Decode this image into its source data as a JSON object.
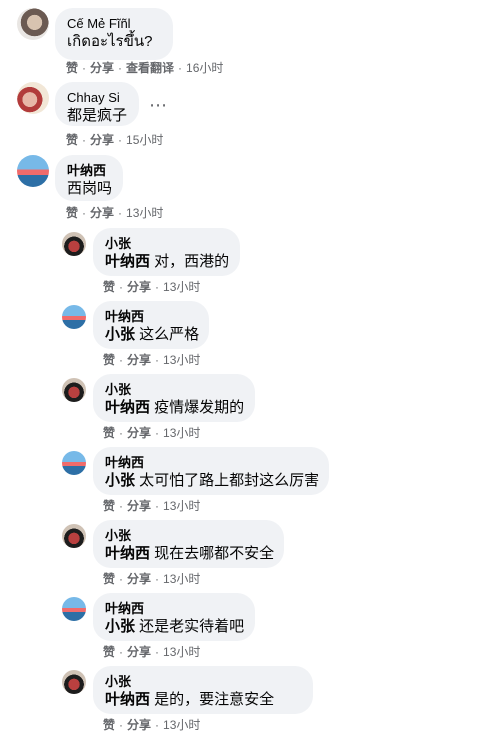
{
  "comments": [
    {
      "author": "Cế Mẻ Fĩñl",
      "text": "เกิดอะไรขึ้น?",
      "like": "赞",
      "share": "分享",
      "translate": "查看翻译",
      "time": "16小时"
    },
    {
      "author": "Chhay Si",
      "text": "都是疯子",
      "like": "赞",
      "share": "分享",
      "time": "15小时"
    },
    {
      "author": "叶纳西",
      "text": "西岗吗",
      "like": "赞",
      "share": "分享",
      "time": "13小时"
    }
  ],
  "replies": [
    {
      "author": "小张",
      "mention": "叶纳西",
      "text": " 对，西港的",
      "like": "赞",
      "share": "分享",
      "time": "13小时"
    },
    {
      "author": "叶纳西",
      "mention": "小张",
      "text": " 这么严格",
      "like": "赞",
      "share": "分享",
      "time": "13小时"
    },
    {
      "author": "小张",
      "mention": "叶纳西",
      "text": " 疫情爆发期的",
      "like": "赞",
      "share": "分享",
      "time": "13小时"
    },
    {
      "author": "叶纳西",
      "mention": "小张",
      "text": " 太可怕了路上都封这么厉害",
      "like": "赞",
      "share": "分享",
      "time": "13小时"
    },
    {
      "author": "小张",
      "mention": "叶纳西",
      "text": " 现在去哪都不安全",
      "like": "赞",
      "share": "分享",
      "time": "13小时"
    },
    {
      "author": "叶纳西",
      "mention": "小张",
      "text": " 还是老实待着吧",
      "like": "赞",
      "share": "分享",
      "time": "13小时"
    },
    {
      "author": "小张",
      "mention": "叶纳西",
      "text": " 是的，要注意安全",
      "like": "赞",
      "share": "分享",
      "time": "13小时"
    }
  ],
  "more_icon": "⋯"
}
